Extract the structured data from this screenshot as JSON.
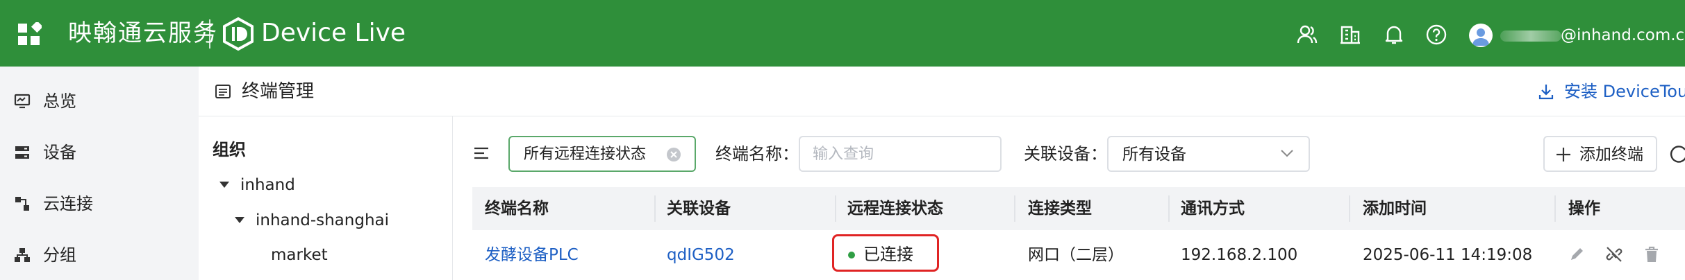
{
  "header": {
    "brand": "映翰通云服务",
    "product": "Device Live",
    "user_email": "@inhand.com.cn"
  },
  "nav": {
    "items": [
      {
        "label": "总览",
        "icon": "monitor-icon"
      },
      {
        "label": "设备",
        "icon": "server-icon"
      },
      {
        "label": "云连接",
        "icon": "connection-icon"
      },
      {
        "label": "分组",
        "icon": "group-icon"
      }
    ]
  },
  "page": {
    "title": "终端管理",
    "install_label": "安装 DeviceTouc"
  },
  "org": {
    "title": "组织",
    "tree": [
      {
        "label": "inhand",
        "level": 0,
        "expanded": true
      },
      {
        "label": "inhand-shanghai",
        "level": 1,
        "expanded": true
      },
      {
        "label": "market",
        "level": 2,
        "expanded": false
      }
    ]
  },
  "filters": {
    "status_chip": "所有远程连接状态",
    "name_label": "终端名称：",
    "name_placeholder": "输入查询",
    "name_value": "",
    "device_label": "关联设备：",
    "device_value": "所有设备",
    "add_label": "添加终端"
  },
  "table": {
    "columns": [
      "终端名称",
      "关联设备",
      "远程连接状态",
      "连接类型",
      "通讯方式",
      "添加时间",
      "操作"
    ],
    "rows": [
      {
        "name": "发酵设备PLC",
        "device": "qdIG502",
        "status": "已连接",
        "conn_type": "网口（二层）",
        "comm": "192.168.2.100",
        "added": "2025-06-11 14:19:08"
      }
    ]
  },
  "colors": {
    "header_green": "#2f8f3a",
    "link_blue": "#1d5fc4",
    "status_green": "#2f9e44",
    "highlight_red": "#e02424"
  }
}
